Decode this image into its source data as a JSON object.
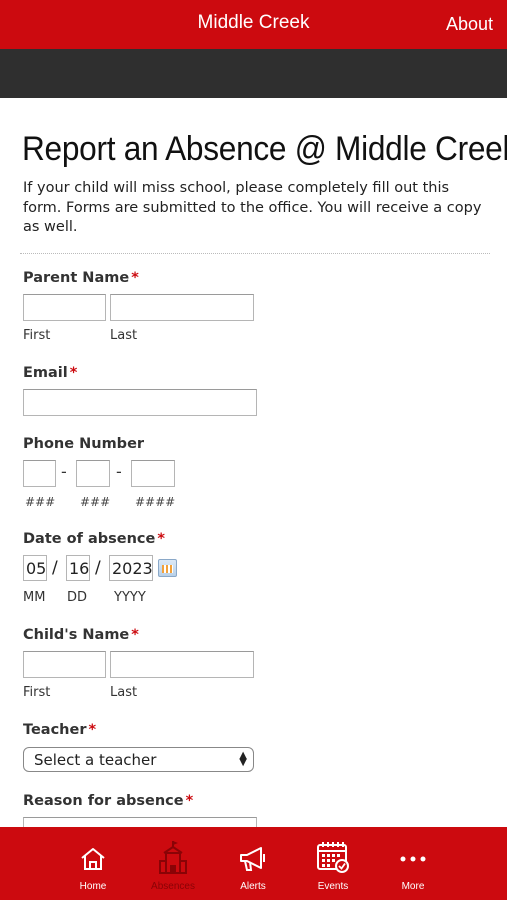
{
  "header": {
    "title": "Middle Creek",
    "about_label": "About"
  },
  "form": {
    "title": "Report an Absence @ Middle Creek",
    "intro": "If your child will miss school, please completely fill out this form. Forms are submitted to the office. You will receive a copy as well.",
    "required_mark": "*",
    "parent_name": {
      "label": "Parent Name",
      "first_sub": "First",
      "last_sub": "Last"
    },
    "email": {
      "label": "Email"
    },
    "phone": {
      "label": "Phone Number",
      "sub1": "###",
      "sub2": "###",
      "sub3": "####",
      "sep": "-"
    },
    "date": {
      "label": "Date of absence",
      "mm": "05",
      "dd": "16",
      "yyyy": "2023",
      "sep": "/",
      "mm_sub": "MM",
      "dd_sub": "DD",
      "yyyy_sub": "YYYY"
    },
    "child_name": {
      "label": "Child's Name",
      "first_sub": "First",
      "last_sub": "Last"
    },
    "teacher": {
      "label": "Teacher",
      "selected": "Select a teacher"
    },
    "reason": {
      "label": "Reason for absence"
    }
  },
  "tabs": [
    {
      "label": "Home",
      "icon": "home-icon",
      "active": false
    },
    {
      "label": "Absences",
      "icon": "school-icon",
      "active": true
    },
    {
      "label": "Alerts",
      "icon": "megaphone-icon",
      "active": false
    },
    {
      "label": "Events",
      "icon": "calendar-icon",
      "active": false
    },
    {
      "label": "More",
      "icon": "more-icon",
      "active": false
    }
  ],
  "colors": {
    "brand_red": "#cc0a0f",
    "dark_bar": "#2f2f2f",
    "active_tab_text": "#8a0306"
  }
}
